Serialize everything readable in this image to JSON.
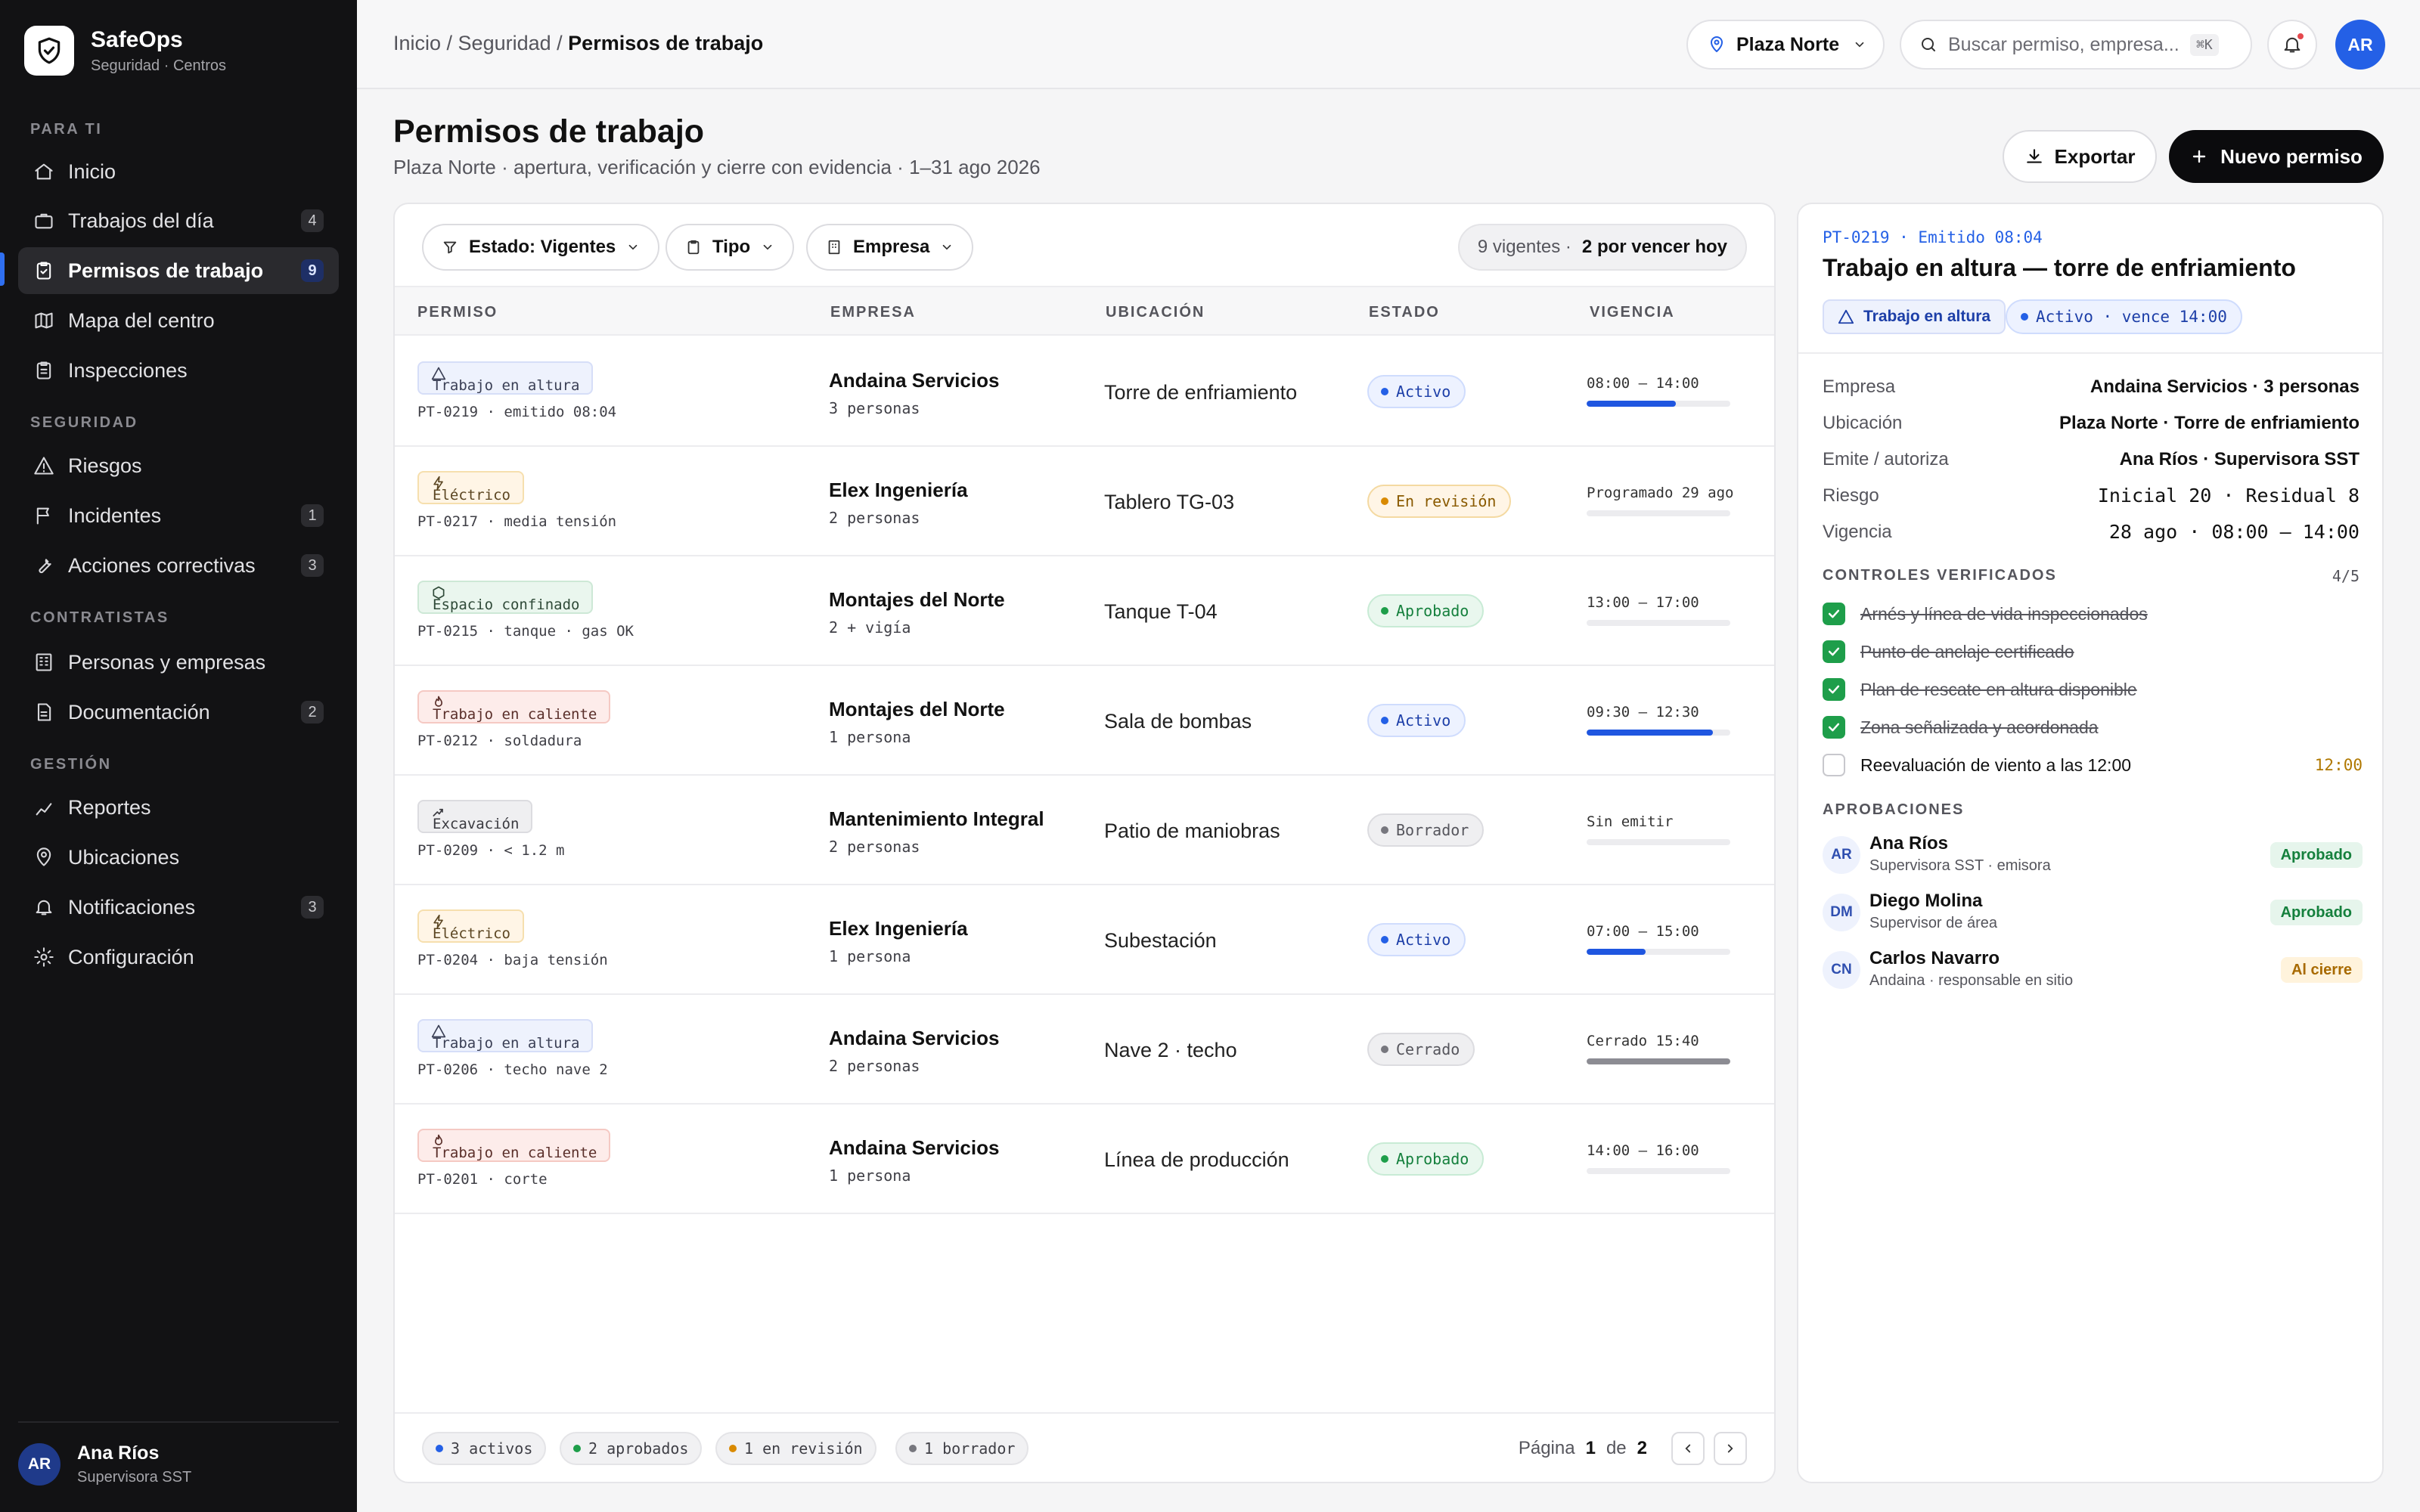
{
  "brand": {
    "name": "SafeOps",
    "subtitle": "Seguridad · Centros"
  },
  "sidebar": {
    "sections": [
      "PARA TI",
      "SEGURIDAD",
      "CONTRATISTAS",
      "GESTIÓN"
    ],
    "items": [
      {
        "label": "Inicio",
        "icon": "home-icon",
        "count": ""
      },
      {
        "label": "Trabajos del día",
        "icon": "briefcase-icon",
        "count": "4"
      },
      {
        "label": "Permisos de trabajo",
        "icon": "clipboard-check-icon",
        "count": "9",
        "active": true
      },
      {
        "label": "Mapa del centro",
        "icon": "map-icon",
        "count": ""
      },
      {
        "label": "Inspecciones",
        "icon": "clipboard-list-icon",
        "count": ""
      },
      {
        "label": "Riesgos",
        "icon": "warning-triangle-icon",
        "count": ""
      },
      {
        "label": "Incidentes",
        "icon": "flag-icon",
        "count": "1"
      },
      {
        "label": "Acciones correctivas",
        "icon": "wrench-icon",
        "count": "3"
      },
      {
        "label": "Personas y empresas",
        "icon": "building-icon",
        "count": ""
      },
      {
        "label": "Documentación",
        "icon": "document-icon",
        "count": "2"
      },
      {
        "label": "Reportes",
        "icon": "chart-line-icon",
        "count": ""
      },
      {
        "label": "Ubicaciones",
        "icon": "map-pin-icon",
        "count": ""
      },
      {
        "label": "Notificaciones",
        "icon": "bell-icon",
        "count": "3"
      },
      {
        "label": "Configuración",
        "icon": "gear-icon",
        "count": ""
      }
    ],
    "user": {
      "initials": "AR",
      "name": "Ana Ríos",
      "role": "Supervisora SST"
    }
  },
  "topbar": {
    "breadcrumb": {
      "part1": "Inicio",
      "part2": "Seguridad",
      "current": "Permisos de trabajo"
    },
    "location": "Plaza Norte",
    "search_placeholder": "Buscar permiso, empresa...",
    "shortcut": "⌘K",
    "avatar": "AR"
  },
  "page": {
    "title": "Permisos de trabajo",
    "subtitle": "Plaza Norte · apertura, verificación y cierre con evidencia · 1–31 ago 2026",
    "export_label": "Exportar",
    "new_label": "Nuevo permiso"
  },
  "filters": {
    "estado": "Estado: Vigentes",
    "tipo": "Tipo",
    "empresa": "Empresa",
    "summary_a": "9 vigentes ·",
    "summary_b": "2 por vencer hoy"
  },
  "table": {
    "columns": [
      "PERMISO",
      "EMPRESA",
      "UBICACIÓN",
      "ESTADO",
      "VIGENCIA"
    ],
    "rows": [
      {
        "type": "Trabajo en altura",
        "type_class": "altura",
        "id": "PT-0219 · emitido 08:04",
        "company": "Andaina Servicios",
        "people": "3 personas",
        "location": "Torre de enfriamiento",
        "status": "Activo",
        "status_class": "activo",
        "validity": "08:00 – 14:00",
        "progress": 0.62
      },
      {
        "type": "Eléctrico",
        "type_class": "elec",
        "id": "PT-0217 · media tensión",
        "company": "Elex Ingeniería",
        "people": "2 personas",
        "location": "Tablero TG-03",
        "status": "En revisión",
        "status_class": "rev",
        "validity": "Programado 29 ago",
        "progress": 0
      },
      {
        "type": "Espacio confinado",
        "type_class": "conf",
        "id": "PT-0215 · tanque · gas OK",
        "company": "Montajes del Norte",
        "people": "2 + vigía",
        "location": "Tanque T-04",
        "status": "Aprobado",
        "status_class": "apr",
        "validity": "13:00 – 17:00",
        "progress": 0
      },
      {
        "type": "Trabajo en caliente",
        "type_class": "cal",
        "id": "PT-0212 · soldadura",
        "company": "Montajes del Norte",
        "people": "1 persona",
        "location": "Sala de bombas",
        "status": "Activo",
        "status_class": "activo",
        "validity": "09:30 – 12:30",
        "progress": 0.88
      },
      {
        "type": "Excavación",
        "type_class": "exc",
        "id": "PT-0209 · < 1.2 m",
        "company": "Mantenimiento Integral",
        "people": "2 personas",
        "location": "Patio de maniobras",
        "status": "Borrador",
        "status_class": "gray",
        "validity": "Sin emitir",
        "progress": 0
      },
      {
        "type": "Eléctrico",
        "type_class": "elec",
        "id": "PT-0204 · baja tensión",
        "company": "Elex Ingeniería",
        "people": "1 persona",
        "location": "Subestación",
        "status": "Activo",
        "status_class": "activo",
        "validity": "07:00 – 15:00",
        "progress": 0.41
      },
      {
        "type": "Trabajo en altura",
        "type_class": "altura",
        "id": "PT-0206 · techo nave 2",
        "company": "Andaina Servicios",
        "people": "2 personas",
        "location": "Nave 2 · techo",
        "status": "Cerrado",
        "status_class": "gray",
        "validity": "Cerrado 15:40",
        "progress": 1,
        "progress_gray": true
      },
      {
        "type": "Trabajo en caliente",
        "type_class": "cal",
        "id": "PT-0201 · corte",
        "company": "Andaina Servicios",
        "people": "1 persona",
        "location": "Línea de producción",
        "status": "Aprobado",
        "status_class": "apr",
        "validity": "14:00 – 16:00",
        "progress": 0
      }
    ],
    "footer": {
      "counts": [
        {
          "label": "3 activos",
          "color": "#2460e6"
        },
        {
          "label": "2 aprobados",
          "color": "#1e9e4a"
        },
        {
          "label": "1 en revisión",
          "color": "#d98a00"
        },
        {
          "label": "1 borrador",
          "color": "#77777e"
        }
      ],
      "page_label": "Página",
      "page": "1",
      "of_label": "de",
      "total_pages": "2"
    }
  },
  "detail": {
    "meta": "PT-0219 · Emitido 08:04",
    "title": "Trabajo en altura — torre de enfriamiento",
    "type_tag": "Trabajo en altura",
    "status_tag": "Activo · vence 14:00",
    "fields": [
      {
        "key": "Empresa",
        "value": "Andaina Servicios · 3 personas"
      },
      {
        "key": "Ubicación",
        "value": "Plaza Norte · Torre de enfriamiento"
      },
      {
        "key": "Emite / autoriza",
        "value": "Ana Ríos · Supervisora SST"
      },
      {
        "key": "Riesgo",
        "value": "Inicial 20 · Residual 8",
        "mono": true
      },
      {
        "key": "Vigencia",
        "value": "28 ago · 08:00 – 14:00",
        "mono": true
      }
    ],
    "controls_title": "CONTROLES VERIFICADOS",
    "controls_count": "4/5",
    "controls": [
      {
        "label": "Arnés y línea de vida inspeccionados",
        "done": true
      },
      {
        "label": "Punto de anclaje certificado",
        "done": true
      },
      {
        "label": "Plan de rescate en altura disponible",
        "done": true
      },
      {
        "label": "Zona señalizada y acordonada",
        "done": true
      },
      {
        "label": "Reevaluación de viento a las 12:00",
        "done": false,
        "time": "12:00"
      }
    ],
    "approvals_title": "APROBACIONES",
    "approvals": [
      {
        "initials": "AR",
        "name": "Ana Ríos",
        "role": "Supervisora SST · emisora",
        "badge": "Aprobado",
        "badge_class": "ok"
      },
      {
        "initials": "DM",
        "name": "Diego Molina",
        "role": "Supervisor de área",
        "badge": "Aprobado",
        "badge_class": "ok"
      },
      {
        "initials": "CN",
        "name": "Carlos Navarro",
        "role": "Andaina · responsable en sitio",
        "badge": "Al cierre",
        "badge_class": "wait"
      }
    ]
  }
}
